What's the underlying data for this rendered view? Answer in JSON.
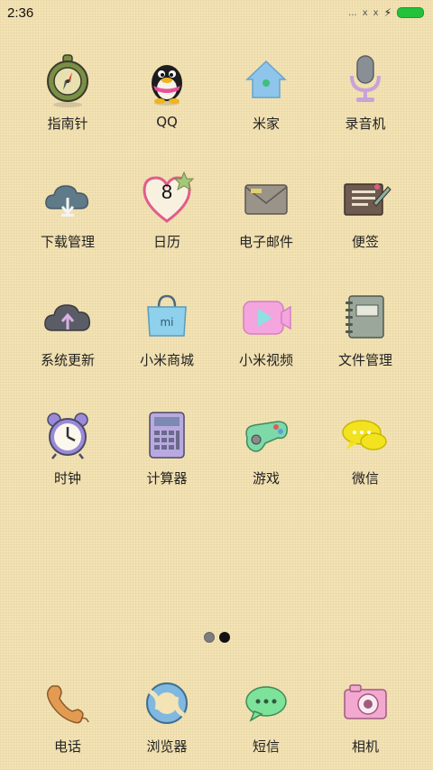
{
  "status_bar": {
    "time": "2:36",
    "signal": "...",
    "x1": "x",
    "x2": "x"
  },
  "apps": [
    {
      "label": "指南针",
      "icon": "compass-icon",
      "name": "app-compass"
    },
    {
      "label": "QQ",
      "icon": "qq-penguin-icon",
      "name": "app-qq"
    },
    {
      "label": "米家",
      "icon": "home-icon",
      "name": "app-mijia"
    },
    {
      "label": "录音机",
      "icon": "microphone-icon",
      "name": "app-recorder"
    },
    {
      "label": "下载管理",
      "icon": "cloud-download-icon",
      "name": "app-downloads"
    },
    {
      "label": "日历",
      "icon": "heart-calendar-icon",
      "name": "app-calendar",
      "date": "8"
    },
    {
      "label": "电子邮件",
      "icon": "envelope-icon",
      "name": "app-email"
    },
    {
      "label": "便签",
      "icon": "notepad-icon",
      "name": "app-notes"
    },
    {
      "label": "系统更新",
      "icon": "cloud-upload-icon",
      "name": "app-system-update"
    },
    {
      "label": "小米商城",
      "icon": "shopping-bag-icon",
      "name": "app-mi-store",
      "badge": "mi"
    },
    {
      "label": "小米视频",
      "icon": "video-play-icon",
      "name": "app-mi-video"
    },
    {
      "label": "文件管理",
      "icon": "notebook-icon",
      "name": "app-file-manager"
    },
    {
      "label": "时钟",
      "icon": "alarm-clock-icon",
      "name": "app-clock"
    },
    {
      "label": "计算器",
      "icon": "calculator-icon",
      "name": "app-calculator"
    },
    {
      "label": "游戏",
      "icon": "gamepad-icon",
      "name": "app-games"
    },
    {
      "label": "微信",
      "icon": "chat-bubble-icon",
      "name": "app-wechat"
    }
  ],
  "pager": {
    "pages": 2,
    "current": 2
  },
  "dock": [
    {
      "label": "电话",
      "icon": "phone-handset-icon",
      "name": "dock-phone"
    },
    {
      "label": "浏览器",
      "icon": "browser-icon",
      "name": "dock-browser"
    },
    {
      "label": "短信",
      "icon": "message-bubble-icon",
      "name": "dock-messages"
    },
    {
      "label": "相机",
      "icon": "camera-icon",
      "name": "dock-camera"
    }
  ],
  "colors": {
    "background": "#f3e3b5",
    "battery": "#23c23a",
    "label_text": "#222222"
  }
}
